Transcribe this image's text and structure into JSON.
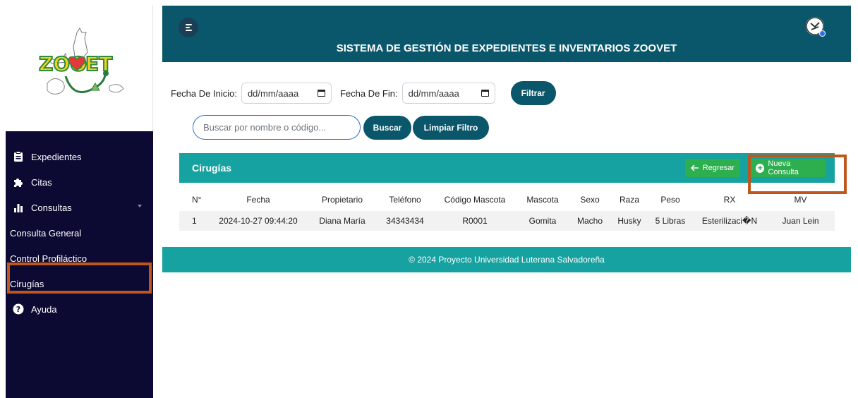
{
  "app": {
    "title": "SISTEMA DE GESTIÓN DE EXPEDIENTES E INVENTARIOS ZOOVET",
    "logo_text": "ZOOVET"
  },
  "sidebar": {
    "items": [
      {
        "label": "Expedientes",
        "icon": "clipboard-icon"
      },
      {
        "label": "Citas",
        "icon": "puzzle-icon"
      },
      {
        "label": "Consultas",
        "icon": "bar-chart-icon"
      },
      {
        "label": "Consulta General"
      },
      {
        "label": "Control Profiláctico"
      },
      {
        "label": "Cirugías"
      },
      {
        "label": "Ayuda",
        "icon": "question-circle-icon"
      }
    ]
  },
  "filters": {
    "start_label": "Fecha De Inicio:",
    "start_value": "dd/mm/aaaa",
    "end_label": "Fecha De Fin:",
    "end_value": "dd/mm/aaaa",
    "filter_button": "Filtrar"
  },
  "search": {
    "placeholder": "Buscar por nombre o código...",
    "search_button": "Buscar",
    "clear_button": "Limpiar Filtro"
  },
  "card": {
    "title": "Cirugías",
    "back_button": "Regresar",
    "new_button": "Nueva Consulta"
  },
  "table": {
    "headers": [
      "N°",
      "Fecha",
      "Propietario",
      "Teléfono",
      "Código Mascota",
      "Mascota",
      "Sexo",
      "Raza",
      "Peso",
      "RX",
      "MV"
    ],
    "rows": [
      [
        "1",
        "2024-10-27 09:44:20",
        "Diana María",
        "34343434",
        "R0001",
        "Gomita",
        "Macho",
        "Husky",
        "5 Libras",
        "Esterilizaci�N",
        "Juan Lein"
      ]
    ]
  },
  "footer": {
    "text": "© 2024 Proyecto Universidad Luterana Salvadoreña"
  },
  "colors": {
    "sidebar": "#0c0a32",
    "topbar": "#0a566b",
    "teal": "#16a2a0",
    "green": "#2dae4f",
    "highlight": "#c0561b"
  }
}
